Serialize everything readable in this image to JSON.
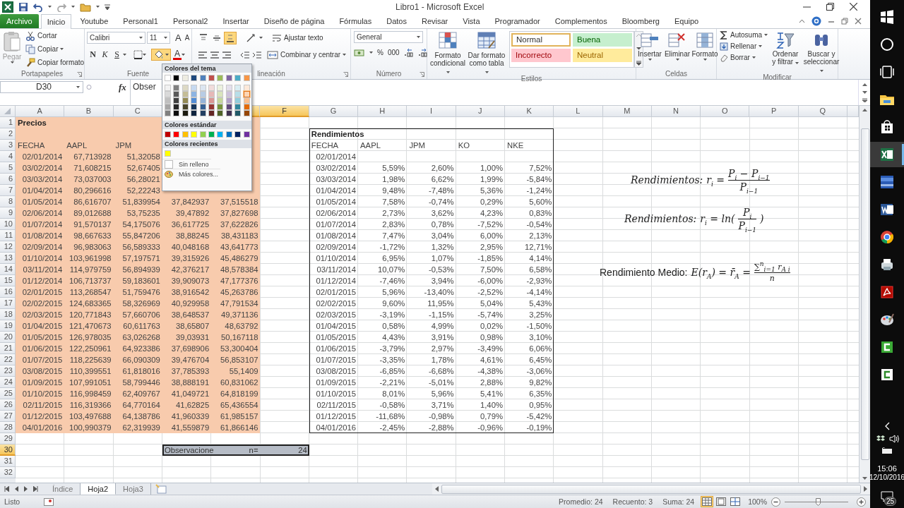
{
  "window": {
    "title": "Libro1 - Microsoft Excel"
  },
  "ribbon_tabs": [
    {
      "label": "Archivo",
      "kind": "file",
      "selected": false
    },
    {
      "label": "Inicio",
      "kind": "tab",
      "selected": true
    },
    {
      "label": "Youtube",
      "kind": "tab",
      "selected": false
    },
    {
      "label": "Personal1",
      "kind": "tab",
      "selected": false
    },
    {
      "label": "Personal2",
      "kind": "tab",
      "selected": false
    },
    {
      "label": "Insertar",
      "kind": "tab",
      "selected": false
    },
    {
      "label": "Diseño de página",
      "kind": "tab",
      "selected": false
    },
    {
      "label": "Fórmulas",
      "kind": "tab",
      "selected": false
    },
    {
      "label": "Datos",
      "kind": "tab",
      "selected": false
    },
    {
      "label": "Revisar",
      "kind": "tab",
      "selected": false
    },
    {
      "label": "Vista",
      "kind": "tab",
      "selected": false
    },
    {
      "label": "Programador",
      "kind": "tab",
      "selected": false
    },
    {
      "label": "Complementos",
      "kind": "tab",
      "selected": false
    },
    {
      "label": "Bloomberg",
      "kind": "tab",
      "selected": false
    },
    {
      "label": "Equipo",
      "kind": "tab",
      "selected": false
    }
  ],
  "clipboard": {
    "label": "Portapapeles",
    "paste": {
      "label": "Pegar",
      "disabled": true
    },
    "items": [
      "Cortar",
      "Copiar",
      "Copiar formato"
    ]
  },
  "font": {
    "label": "Fuente",
    "font_name": "Calibri",
    "font_size": "11",
    "grow": "A",
    "shrink": "A",
    "style_buttons": [
      "N",
      "K",
      "S"
    ],
    "fill_button": {
      "selected": true
    },
    "font_color": "A"
  },
  "alignment": {
    "label": "lineación",
    "vertical": [
      {
        "selected": false
      },
      {
        "selected": false
      },
      {
        "selected": true
      }
    ],
    "wrap": "Ajustar texto",
    "merge": "Combinar y centrar"
  },
  "number": {
    "label": "Número",
    "format": "General",
    "buttons": [
      "%",
      "000"
    ]
  },
  "styles": {
    "label": "Estilos",
    "buttons": [
      "Formato condicional",
      "Dar formato como tabla"
    ],
    "cell_styles": [
      {
        "label": "Normal",
        "color": "#ffffff",
        "selected": true
      },
      {
        "label": "Buena",
        "color": "#c6efce",
        "selected": false
      },
      {
        "label": "Incorrecto",
        "color": "#ffc7ce",
        "selected": false
      },
      {
        "label": "Neutral",
        "color": "#ffeb9c",
        "selected": false
      }
    ]
  },
  "cells": {
    "label": "Celdas",
    "buttons": [
      "Insertar",
      "Eliminar",
      "Formato"
    ]
  },
  "editing": {
    "label": "Modificar",
    "items": [
      "Autosuma",
      "Rellenar",
      "Borrar"
    ],
    "buttons": [
      "Ordenar y filtrar",
      "Buscar y seleccionar"
    ]
  },
  "formula_bar": {
    "name_box": "D30",
    "function_label": "fx",
    "content": "Obser"
  },
  "color_menu": {
    "theme_title": "Colores del tema",
    "theme_colors": [
      {
        "color": "#ffffff",
        "selected": false
      },
      {
        "color": "#000000",
        "selected": false
      },
      {
        "color": "#eeece1",
        "selected": false
      },
      {
        "color": "#1f497d",
        "selected": false
      },
      {
        "color": "#4f81bd",
        "selected": false
      },
      {
        "color": "#c0504d",
        "selected": false
      },
      {
        "color": "#9bbb59",
        "selected": false
      },
      {
        "color": "#8064a2",
        "selected": false
      },
      {
        "color": "#4bacc6",
        "selected": false
      },
      {
        "color": "#f79646",
        "selected": false
      },
      {
        "color": "#f2f2f2",
        "selected": false
      },
      {
        "color": "#7f7f7f",
        "selected": false
      },
      {
        "color": "#ddd9c4",
        "selected": false
      },
      {
        "color": "#c6d9f0",
        "selected": false
      },
      {
        "color": "#dce6f1",
        "selected": false
      },
      {
        "color": "#f2dcdb",
        "selected": false
      },
      {
        "color": "#ebf1de",
        "selected": false
      },
      {
        "color": "#e4dfec",
        "selected": false
      },
      {
        "color": "#daeef3",
        "selected": false
      },
      {
        "color": "#fde9d9",
        "selected": false
      },
      {
        "color": "#d9d9d9",
        "selected": false
      },
      {
        "color": "#595959",
        "selected": false
      },
      {
        "color": "#c4bd97",
        "selected": false
      },
      {
        "color": "#8db4e2",
        "selected": false
      },
      {
        "color": "#b8cce4",
        "selected": false
      },
      {
        "color": "#e6b8b7",
        "selected": false
      },
      {
        "color": "#d8e4bc",
        "selected": false
      },
      {
        "color": "#ccc0da",
        "selected": false
      },
      {
        "color": "#b7dee8",
        "selected": false
      },
      {
        "color": "#fcd5b4",
        "selected": true
      },
      {
        "color": "#bfbfbf",
        "selected": false
      },
      {
        "color": "#404040",
        "selected": false
      },
      {
        "color": "#948a54",
        "selected": false
      },
      {
        "color": "#538dd5",
        "selected": false
      },
      {
        "color": "#95b3d7",
        "selected": false
      },
      {
        "color": "#da9694",
        "selected": false
      },
      {
        "color": "#c4d79b",
        "selected": false
      },
      {
        "color": "#b1a0c7",
        "selected": false
      },
      {
        "color": "#92cddc",
        "selected": false
      },
      {
        "color": "#fabf8f",
        "selected": false
      },
      {
        "color": "#a6a6a6",
        "selected": false
      },
      {
        "color": "#262626",
        "selected": false
      },
      {
        "color": "#4a452a",
        "selected": false
      },
      {
        "color": "#16365c",
        "selected": false
      },
      {
        "color": "#366092",
        "selected": false
      },
      {
        "color": "#963634",
        "selected": false
      },
      {
        "color": "#76933c",
        "selected": false
      },
      {
        "color": "#60497a",
        "selected": false
      },
      {
        "color": "#31869b",
        "selected": false
      },
      {
        "color": "#e26b0a",
        "selected": false
      },
      {
        "color": "#808080",
        "selected": false
      },
      {
        "color": "#0d0d0d",
        "selected": false
      },
      {
        "color": "#1d1b10",
        "selected": false
      },
      {
        "color": "#0f243e",
        "selected": false
      },
      {
        "color": "#244062",
        "selected": false
      },
      {
        "color": "#632523",
        "selected": false
      },
      {
        "color": "#4f6228",
        "selected": false
      },
      {
        "color": "#403151",
        "selected": false
      },
      {
        "color": "#215967",
        "selected": false
      },
      {
        "color": "#974706",
        "selected": false
      }
    ],
    "standard_title": "Colores estándar",
    "standard_colors": [
      {
        "color": "#c00000"
      },
      {
        "color": "#ff0000"
      },
      {
        "color": "#ffc000"
      },
      {
        "color": "#ffff00"
      },
      {
        "color": "#92d050"
      },
      {
        "color": "#00b050"
      },
      {
        "color": "#00b0f0"
      },
      {
        "color": "#0070c0"
      },
      {
        "color": "#002060"
      },
      {
        "color": "#7030a0"
      }
    ],
    "recent_title": "Colores recientes",
    "recent_colors": [
      {
        "color": "#ffff00"
      }
    ],
    "items": [
      {
        "label": "Sin relleno",
        "kind": "none"
      },
      {
        "label": "Más colores...",
        "kind": "more"
      }
    ]
  },
  "sheet": {
    "columns": [
      {
        "label": "A",
        "selected": false
      },
      {
        "label": "B",
        "selected": false
      },
      {
        "label": "C",
        "selected": false
      },
      {},
      {
        "selected": true
      },
      {
        "label": "F",
        "selected": true
      },
      {
        "label": "G",
        "selected": false
      },
      {
        "label": "H",
        "selected": false
      },
      {
        "label": "I",
        "selected": false
      },
      {
        "label": "J",
        "selected": false
      },
      {
        "label": "K",
        "selected": false
      },
      {
        "label": "L",
        "selected": false
      },
      {
        "label": "M",
        "selected": false
      },
      {
        "label": "N",
        "selected": false
      },
      {
        "label": "O",
        "selected": false
      },
      {
        "label": "P",
        "selected": false
      },
      {
        "label": "Q",
        "selected": false
      }
    ],
    "rows": [
      {
        "number": "1",
        "kind": "title",
        "selected": false,
        "price_fill": true,
        "framed": false,
        "cells": [
          "Precios",
          null,
          null,
          null,
          null,
          null,
          null,
          null,
          null,
          null,
          null
        ]
      },
      {
        "number": "2",
        "kind": "title",
        "selected": false,
        "price_fill": true,
        "framed": true,
        "cells": [
          null,
          null,
          null,
          null,
          null,
          null,
          "Rendimientos",
          null,
          null,
          null,
          null
        ]
      },
      {
        "number": "3",
        "kind": "header",
        "selected": false,
        "price_fill": true,
        "framed": true,
        "cells": [
          "FECHA",
          "AAPL",
          "JPM",
          null,
          null,
          null,
          "FECHA",
          "AAPL",
          "JPM",
          "KO",
          "NKE"
        ]
      },
      {
        "number": "4",
        "kind": "data",
        "selected": false,
        "price_fill": true,
        "framed": true,
        "cells": [
          "02/01/2014",
          "67,713928",
          "51,32058",
          null,
          null,
          null,
          "02/01/2014",
          null,
          null,
          null,
          null
        ]
      },
      {
        "number": "5",
        "kind": "data",
        "selected": false,
        "price_fill": true,
        "framed": true,
        "cells": [
          "03/02/2014",
          "71,608215",
          "52,67405",
          null,
          null,
          null,
          "03/02/2014",
          "5,59%",
          "2,60%",
          "1,00%",
          "7,52%"
        ]
      },
      {
        "number": "6",
        "kind": "data",
        "selected": false,
        "price_fill": true,
        "framed": true,
        "cells": [
          "03/03/2014",
          "73,037003",
          "56,28021",
          null,
          null,
          null,
          "03/03/2014",
          "1,98%",
          "6,62%",
          "1,99%",
          "-5,84%"
        ]
      },
      {
        "number": "7",
        "kind": "data",
        "selected": false,
        "price_fill": true,
        "framed": true,
        "cells": [
          "01/04/2014",
          "80,296616",
          "52,22243",
          null,
          null,
          null,
          "01/04/2014",
          "9,48%",
          "-7,48%",
          "5,36%",
          "-1,24%"
        ]
      },
      {
        "number": "8",
        "kind": "data",
        "selected": false,
        "price_fill": true,
        "framed": true,
        "cells": [
          "01/05/2014",
          "86,616707",
          "51,839954",
          "37,842937",
          "37,515518",
          null,
          "01/05/2014",
          "7,58%",
          "-0,74%",
          "0,29%",
          "5,60%"
        ]
      },
      {
        "number": "9",
        "kind": "data",
        "selected": false,
        "price_fill": true,
        "framed": true,
        "cells": [
          "02/06/2014",
          "89,012688",
          "53,75235",
          "39,47892",
          "37,827698",
          null,
          "02/06/2014",
          "2,73%",
          "3,62%",
          "4,23%",
          "0,83%"
        ]
      },
      {
        "number": "10",
        "kind": "data",
        "selected": false,
        "price_fill": true,
        "framed": true,
        "cells": [
          "01/07/2014",
          "91,570137",
          "54,175076",
          "36,617725",
          "37,622826",
          null,
          "01/07/2014",
          "2,83%",
          "0,78%",
          "-7,52%",
          "-0,54%"
        ]
      },
      {
        "number": "11",
        "kind": "data",
        "selected": false,
        "price_fill": true,
        "framed": true,
        "cells": [
          "01/08/2014",
          "98,667633",
          "55,847206",
          "38,88245",
          "38,431183",
          null,
          "01/08/2014",
          "7,47%",
          "3,04%",
          "6,00%",
          "2,13%"
        ]
      },
      {
        "number": "12",
        "kind": "data",
        "selected": false,
        "price_fill": true,
        "framed": true,
        "cells": [
          "02/09/2014",
          "96,983063",
          "56,589333",
          "40,048168",
          "43,641773",
          null,
          "02/09/2014",
          "-1,72%",
          "1,32%",
          "2,95%",
          "12,71%"
        ]
      },
      {
        "number": "13",
        "kind": "data",
        "selected": false,
        "price_fill": true,
        "framed": true,
        "cells": [
          "01/10/2014",
          "103,961998",
          "57,197571",
          "39,315926",
          "45,486279",
          null,
          "01/10/2014",
          "6,95%",
          "1,07%",
          "-1,85%",
          "4,14%"
        ]
      },
      {
        "number": "14",
        "kind": "data",
        "selected": false,
        "price_fill": true,
        "framed": true,
        "cells": [
          "03/11/2014",
          "114,979759",
          "56,894939",
          "42,376217",
          "48,578384",
          null,
          "03/11/2014",
          "10,07%",
          "-0,53%",
          "7,50%",
          "6,58%"
        ]
      },
      {
        "number": "15",
        "kind": "data",
        "selected": false,
        "price_fill": true,
        "framed": true,
        "cells": [
          "01/12/2014",
          "106,713737",
          "59,183601",
          "39,909073",
          "47,177376",
          null,
          "01/12/2014",
          "-7,46%",
          "3,94%",
          "-6,00%",
          "-2,93%"
        ]
      },
      {
        "number": "16",
        "kind": "data",
        "selected": false,
        "price_fill": true,
        "framed": true,
        "cells": [
          "02/01/2015",
          "113,268547",
          "51,759476",
          "38,916542",
          "45,263786",
          null,
          "02/01/2015",
          "5,96%",
          "-13,40%",
          "-2,52%",
          "-4,14%"
        ]
      },
      {
        "number": "17",
        "kind": "data",
        "selected": false,
        "price_fill": true,
        "framed": true,
        "cells": [
          "02/02/2015",
          "124,683365",
          "58,326969",
          "40,929958",
          "47,791534",
          null,
          "02/02/2015",
          "9,60%",
          "11,95%",
          "5,04%",
          "5,43%"
        ]
      },
      {
        "number": "18",
        "kind": "data",
        "selected": false,
        "price_fill": true,
        "framed": true,
        "cells": [
          "02/03/2015",
          "120,771843",
          "57,660706",
          "38,648537",
          "49,371136",
          null,
          "02/03/2015",
          "-3,19%",
          "-1,15%",
          "-5,74%",
          "3,25%"
        ]
      },
      {
        "number": "19",
        "kind": "data",
        "selected": false,
        "price_fill": true,
        "framed": true,
        "cells": [
          "01/04/2015",
          "121,470673",
          "60,611763",
          "38,65807",
          "48,63792",
          null,
          "01/04/2015",
          "0,58%",
          "4,99%",
          "0,02%",
          "-1,50%"
        ]
      },
      {
        "number": "20",
        "kind": "data",
        "selected": false,
        "price_fill": true,
        "framed": true,
        "cells": [
          "01/05/2015",
          "126,978035",
          "63,026268",
          "39,03931",
          "50,167118",
          null,
          "01/05/2015",
          "4,43%",
          "3,91%",
          "0,98%",
          "3,10%"
        ]
      },
      {
        "number": "21",
        "kind": "data",
        "selected": false,
        "price_fill": true,
        "framed": true,
        "cells": [
          "01/06/2015",
          "122,250961",
          "64,923386",
          "37,698906",
          "53,300404",
          null,
          "01/06/2015",
          "-3,79%",
          "2,97%",
          "-3,49%",
          "6,06%"
        ]
      },
      {
        "number": "22",
        "kind": "data",
        "selected": false,
        "price_fill": true,
        "framed": true,
        "cells": [
          "01/07/2015",
          "118,225639",
          "66,090309",
          "39,476704",
          "56,853107",
          null,
          "01/07/2015",
          "-3,35%",
          "1,78%",
          "4,61%",
          "6,45%"
        ]
      },
      {
        "number": "23",
        "kind": "data",
        "selected": false,
        "price_fill": true,
        "framed": true,
        "cells": [
          "03/08/2015",
          "110,399551",
          "61,818016",
          "37,785393",
          "55,1409",
          null,
          "03/08/2015",
          "-6,85%",
          "-6,68%",
          "-4,38%",
          "-3,06%"
        ]
      },
      {
        "number": "24",
        "kind": "data",
        "selected": false,
        "price_fill": true,
        "framed": true,
        "cells": [
          "01/09/2015",
          "107,991051",
          "58,799446",
          "38,888191",
          "60,831062",
          null,
          "01/09/2015",
          "-2,21%",
          "-5,01%",
          "2,88%",
          "9,82%"
        ]
      },
      {
        "number": "25",
        "kind": "data",
        "selected": false,
        "price_fill": true,
        "framed": true,
        "cells": [
          "01/10/2015",
          "116,998459",
          "62,409767",
          "41,049721",
          "64,818199",
          null,
          "01/10/2015",
          "8,01%",
          "5,96%",
          "5,41%",
          "6,35%"
        ]
      },
      {
        "number": "26",
        "kind": "data",
        "selected": false,
        "price_fill": true,
        "framed": true,
        "cells": [
          "02/11/2015",
          "116,319366",
          "64,770164",
          "41,62825",
          "65,436554",
          null,
          "02/11/2015",
          "-0,58%",
          "3,71%",
          "1,40%",
          "0,95%"
        ]
      },
      {
        "number": "27",
        "kind": "data",
        "selected": false,
        "price_fill": true,
        "framed": true,
        "cells": [
          "01/12/2015",
          "103,497688",
          "64,138786",
          "41,960339",
          "61,985157",
          null,
          "01/12/2015",
          "-11,68%",
          "-0,98%",
          "0,79%",
          "-5,42%"
        ]
      },
      {
        "number": "28",
        "kind": "data",
        "selected": false,
        "price_fill": true,
        "framed": true,
        "cells": [
          "04/01/2016",
          "100,990379",
          "62,319939",
          "41,559879",
          "61,866146",
          null,
          "04/01/2016",
          "-2,45%",
          "-2,88%",
          "-0,96%",
          "-0,19%"
        ]
      },
      {
        "number": "29",
        "kind": "blank",
        "selected": false,
        "price_fill": false,
        "framed": false,
        "cells": [
          null,
          null,
          null,
          null,
          null,
          null,
          null,
          null,
          null,
          null,
          null
        ]
      },
      {
        "number": "30",
        "kind": "summary",
        "selected": true,
        "price_fill": false,
        "framed": false,
        "cells": [
          null,
          null,
          null,
          "Observacione",
          "n=",
          "24",
          null,
          null,
          null,
          null,
          null
        ]
      },
      {
        "number": "31",
        "kind": "blank",
        "selected": false,
        "price_fill": false,
        "framed": false,
        "cells": [
          null,
          null,
          null,
          null,
          null,
          null,
          null,
          null,
          null,
          null,
          null
        ]
      },
      {
        "number": "32",
        "kind": "blank",
        "selected": false,
        "price_fill": false,
        "framed": false,
        "cells": [
          null,
          null,
          null,
          null,
          null,
          null,
          null,
          null,
          null,
          null,
          null
        ]
      }
    ]
  },
  "formulas": [
    {
      "kind": "fraction",
      "label": "Rendimientos:",
      "lhs": "r$_{i}$ =",
      "numerator": "P$_{i}$ − P$_{i−1}$",
      "denominator": "P$_{i−1}$"
    },
    {
      "kind": "log",
      "label": "Rendimientos:",
      "lhs": "r$_{i}$ = ln(",
      "numerator": "P$_{i}$",
      "denominator": "P$_{i−1}$",
      "rhs": ")"
    },
    {
      "kind": "mean",
      "label": "Rendimiento Medio:",
      "lhs": "E(r$_{A}$) = r̄$_{A}$ =",
      "numerator": "∑$^{n}$$_{i=1}$ r$_{A i}$",
      "denominator": "n"
    }
  ],
  "sheet_tabs": [
    {
      "label": "Índice",
      "selected": false
    },
    {
      "label": "Hoja2",
      "selected": true
    },
    {
      "label": "Hoja3",
      "selected": false
    }
  ],
  "status_bar": {
    "mode": "Listo",
    "stats": [
      "Promedio: 24",
      "Recuento: 3",
      "Suma: 24"
    ],
    "views": [
      {
        "kind": "normal",
        "selected": true
      },
      {
        "kind": "layout",
        "selected": false
      },
      {
        "kind": "pagebreak",
        "selected": false
      }
    ],
    "zoom": "100%"
  },
  "taskbar": {
    "apps": [
      {
        "kind": "start",
        "selected": false
      },
      {
        "kind": "search",
        "selected": false
      },
      {
        "kind": "taskview",
        "selected": false
      },
      {
        "kind": "folder",
        "selected": false
      },
      {
        "kind": "store",
        "selected": false
      },
      {
        "kind": "sheet",
        "selected": true
      },
      {
        "kind": "dev",
        "selected": false
      },
      {
        "kind": "doc",
        "selected": false
      },
      {
        "kind": "circle",
        "selected": false
      },
      {
        "kind": "printer",
        "selected": false
      },
      {
        "kind": "pdf",
        "selected": false
      },
      {
        "kind": "palette",
        "selected": false
      },
      {
        "kind": "cgreen",
        "selected": false
      },
      {
        "kind": "cwhite",
        "selected": false
      }
    ],
    "time": "15:06",
    "date": "12/10/2016",
    "notifications": "25"
  }
}
